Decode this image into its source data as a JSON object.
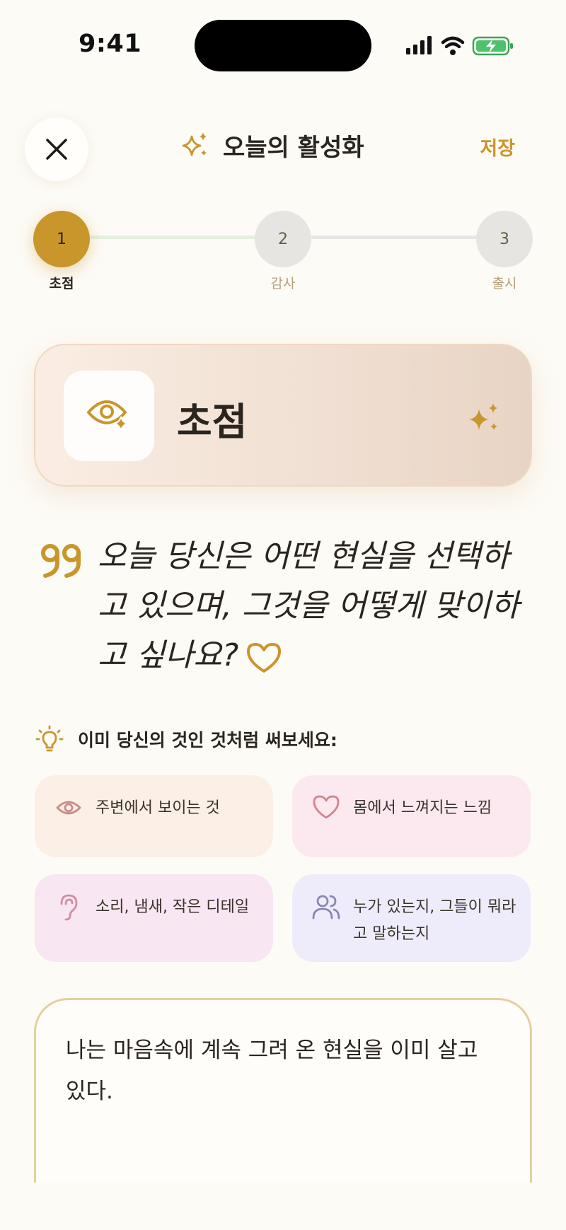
{
  "status_bar": {
    "time": "9:41"
  },
  "header": {
    "title": "오늘의 활성화",
    "save_label": "저장"
  },
  "stepper": {
    "current": 1,
    "steps": [
      {
        "number": "1",
        "label": "초점"
      },
      {
        "number": "2",
        "label": "감사"
      },
      {
        "number": "3",
        "label": "출시"
      }
    ]
  },
  "focus_card": {
    "title": "초점"
  },
  "question": {
    "text": "오늘 당신은 어떤 현실을 선택하고 있으며, 그것을 어떻게 맞이하고 싶나요?"
  },
  "hint": {
    "text": "이미 당신의 것인 것처럼 써보세요:"
  },
  "prompts": [
    {
      "label": "주변에서 보이는 것",
      "icon": "eye-icon"
    },
    {
      "label": "몸에서 느껴지는 느낌",
      "icon": "heart-icon"
    },
    {
      "label": "소리, 냄새, 작은 디테일",
      "icon": "ear-icon"
    },
    {
      "label": "누가 있는지, 그들이 뭐라고 말하는지",
      "icon": "people-icon"
    }
  ],
  "answer": {
    "value": "나는 마음속에 계속 그려 온 현실을 이미 살고 있다."
  },
  "colors": {
    "accent": "#c9962b",
    "background": "#fdfbf6",
    "text": "#2b2520"
  }
}
